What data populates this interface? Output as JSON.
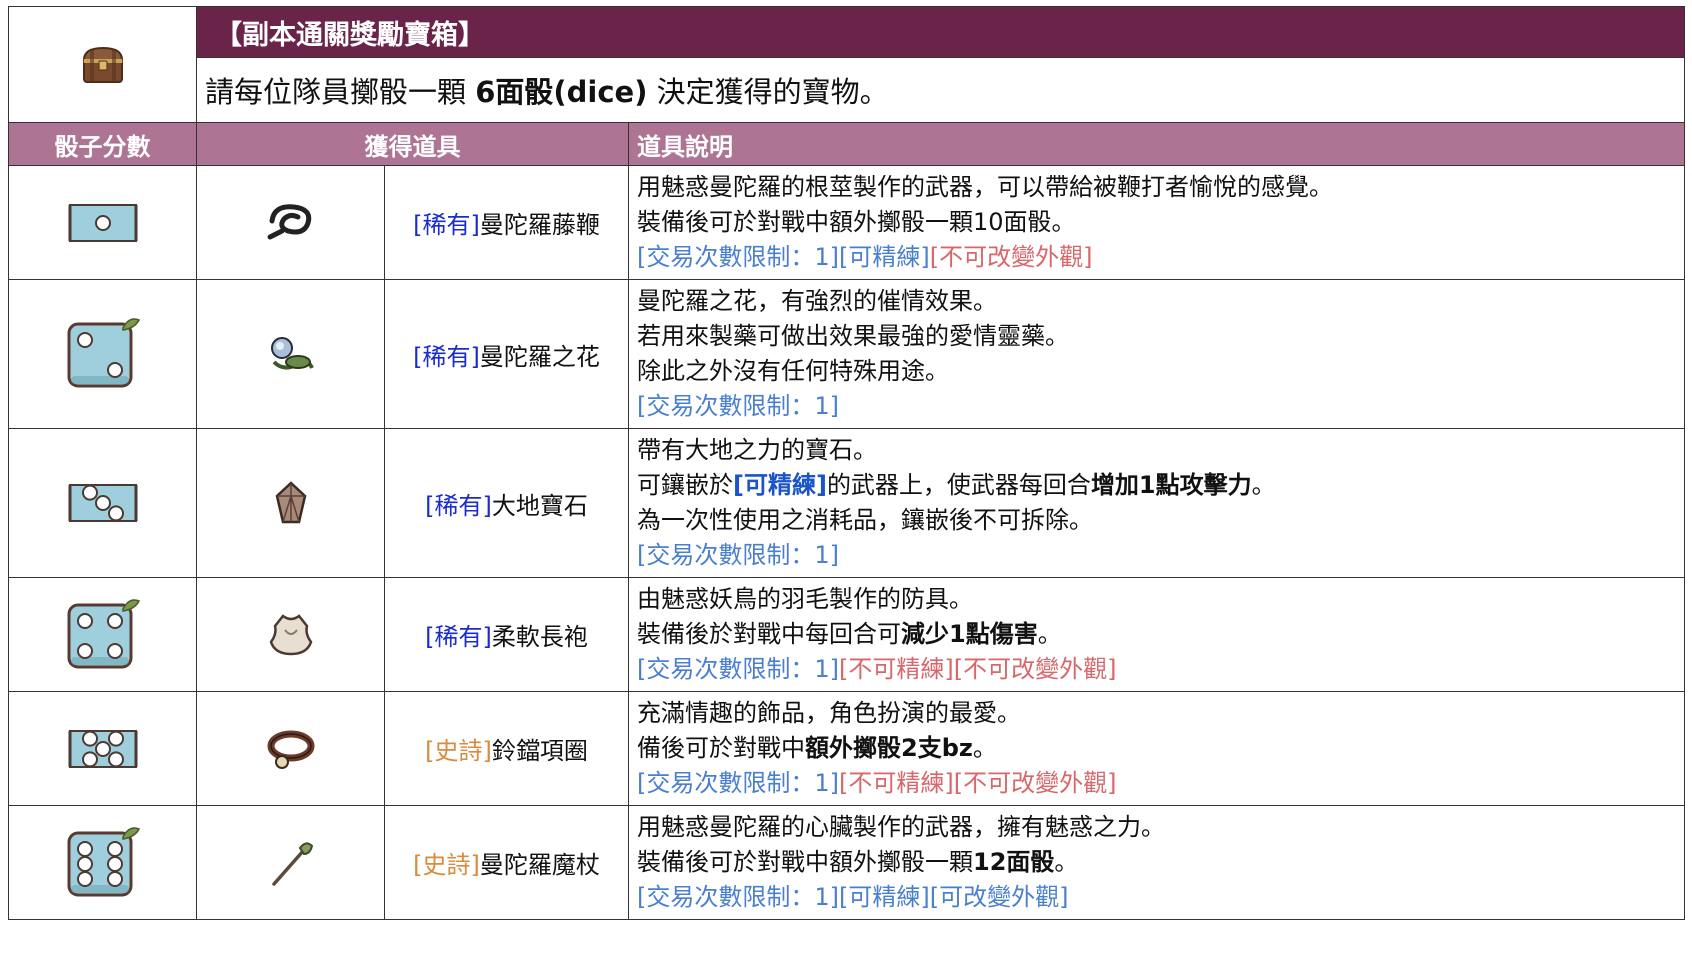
{
  "banner": {
    "title": "【副本通關獎勵寶箱】",
    "sub_before": "請每位隊員擲骰一顆 ",
    "sub_bold": "6面骰(dice)",
    "sub_after": " 決定獲得的寶物。"
  },
  "headers": {
    "dice": "骰子分數",
    "item": "獲得道具",
    "desc": "道具說明"
  },
  "colors": {
    "banner_bg": "#6b2449",
    "header_bg": "#ad7494",
    "rare": "#1a2ccf",
    "epic": "#d98a3c",
    "limit_blue": "#4a7fd0",
    "limit_red": "#d9666a"
  },
  "rows": [
    {
      "dice_face": 1,
      "item_icon": "whip-icon",
      "tag": "[稀有]",
      "tag_type": "rare",
      "name": "曼陀羅藤鞭",
      "desc": [
        {
          "parts": [
            {
              "t": "用魅惑曼陀羅的根莖製作的武器，可以帶給被鞭打者愉悅的感覺。"
            }
          ]
        },
        {
          "parts": [
            {
              "t": "裝備後可於對戰中額外擲骰一顆10面骰。"
            }
          ]
        },
        {
          "parts": [
            {
              "t": "[交易次數限制：1][可精練]",
              "c": "blue"
            },
            {
              "t": "[不可改變外觀]",
              "c": "red"
            }
          ]
        }
      ]
    },
    {
      "dice_face": 2,
      "item_icon": "flower-icon",
      "tag": "[稀有]",
      "tag_type": "rare",
      "name": "曼陀羅之花",
      "desc": [
        {
          "parts": [
            {
              "t": "曼陀羅之花，有強烈的催情效果。"
            }
          ]
        },
        {
          "parts": [
            {
              "t": "若用來製藥可做出效果最強的愛情靈藥。"
            }
          ]
        },
        {
          "parts": [
            {
              "t": "除此之外沒有任何特殊用途。"
            }
          ]
        },
        {
          "parts": [
            {
              "t": "[交易次數限制：1]",
              "c": "blue"
            }
          ]
        }
      ]
    },
    {
      "dice_face": 3,
      "item_icon": "gem-icon",
      "tag": "[稀有]",
      "tag_type": "rare",
      "name": "大地寶石",
      "desc": [
        {
          "parts": [
            {
              "t": "帶有大地之力的寶石。"
            }
          ]
        },
        {
          "parts": [
            {
              "t": "可鑲嵌於"
            },
            {
              "t": "[可精練]",
              "c": "hl-blue"
            },
            {
              "t": "的武器上，使武器每回合"
            },
            {
              "t": "增加1點攻擊力",
              "b": true
            },
            {
              "t": "。"
            }
          ]
        },
        {
          "parts": [
            {
              "t": "為一次性使用之消耗品，鑲嵌後不可拆除。"
            }
          ]
        },
        {
          "parts": [
            {
              "t": "[交易次數限制：1]",
              "c": "blue"
            }
          ]
        }
      ]
    },
    {
      "dice_face": 4,
      "item_icon": "robe-icon",
      "tag": "[稀有]",
      "tag_type": "rare",
      "name": "柔軟長袍",
      "desc": [
        {
          "parts": [
            {
              "t": "由魅惑妖鳥的羽毛製作的防具。"
            }
          ]
        },
        {
          "parts": [
            {
              "t": "裝備後於對戰中每回合可"
            },
            {
              "t": "減少1點傷害",
              "b": true
            },
            {
              "t": "。"
            }
          ]
        },
        {
          "parts": [
            {
              "t": "[交易次數限制：1]",
              "c": "blue"
            },
            {
              "t": "[不可精練][不可改變外觀]",
              "c": "red"
            }
          ]
        }
      ]
    },
    {
      "dice_face": 5,
      "item_icon": "collar-icon",
      "tag": "[史詩]",
      "tag_type": "epic",
      "name": "鈴鐺項圈",
      "desc": [
        {
          "parts": [
            {
              "t": "充滿情趣的飾品，角色扮演的最愛。"
            }
          ]
        },
        {
          "parts": [
            {
              "t": "備後可於對戰中"
            },
            {
              "t": "額外擲骰2支bz",
              "b": true
            },
            {
              "t": "。"
            }
          ]
        },
        {
          "parts": [
            {
              "t": "[交易次數限制：1]",
              "c": "blue"
            },
            {
              "t": "[不可精練][不可改變外觀]",
              "c": "red"
            }
          ]
        }
      ]
    },
    {
      "dice_face": 6,
      "item_icon": "staff-icon",
      "tag": "[史詩]",
      "tag_type": "epic",
      "name": "曼陀羅魔杖",
      "desc": [
        {
          "parts": [
            {
              "t": "用魅惑曼陀羅的心臟製作的武器，擁有魅惑之力。"
            }
          ]
        },
        {
          "parts": [
            {
              "t": "裝備後可於對戰中額外擲骰一顆"
            },
            {
              "t": "12面骰",
              "b": true
            },
            {
              "t": "。"
            }
          ]
        },
        {
          "parts": [
            {
              "t": "[交易次數限制：1][可精練][可改變外觀]",
              "c": "blue"
            }
          ]
        }
      ]
    }
  ]
}
